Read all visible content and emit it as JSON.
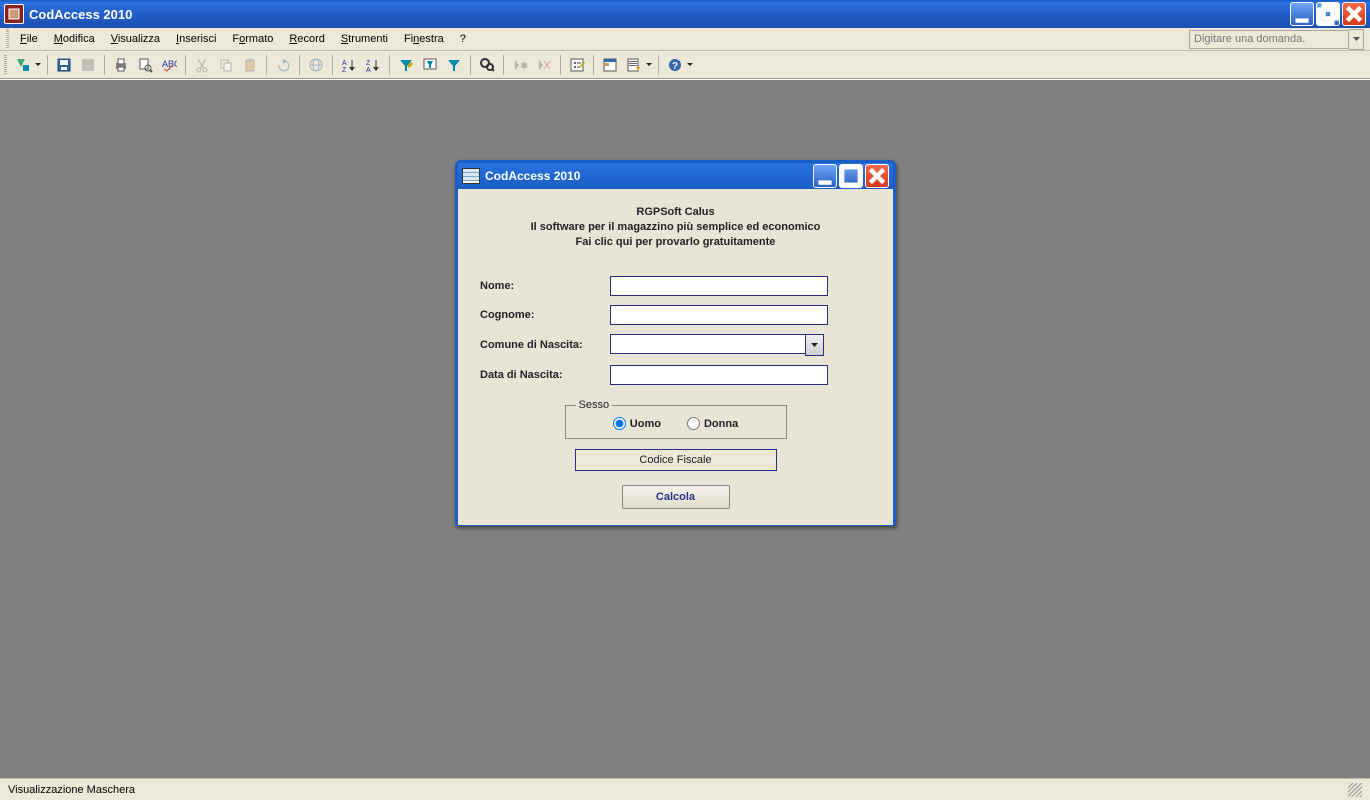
{
  "app_title": "CodAccess 2010",
  "ask_placeholder": "Digitare una domanda.",
  "menu": {
    "file": "File",
    "modifica": "Modifica",
    "visualizza": "Visualizza",
    "inserisci": "Inserisci",
    "formato": "Formato",
    "record": "Record",
    "strumenti": "Strumenti",
    "finestra": "Finestra",
    "help": "?"
  },
  "inner_title": "CodAccess 2010",
  "ad": {
    "line1": "RGPSoft Calus",
    "line2": "Il software per il magazzino più semplice ed economico",
    "line3": "Fai clic qui per provarlo gratuitamente"
  },
  "labels": {
    "nome": "Nome:",
    "cognome": "Cognome:",
    "comune": "Comune di Nascita:",
    "data": "Data di Nascita:",
    "sesso": "Sesso",
    "uomo": "Uomo",
    "donna": "Donna",
    "codice": "Codice Fiscale",
    "calcola": "Calcola"
  },
  "values": {
    "nome": "",
    "cognome": "",
    "comune": "",
    "data": ""
  },
  "sesso_selected": "uomo",
  "status": "Visualizzazione Maschera"
}
